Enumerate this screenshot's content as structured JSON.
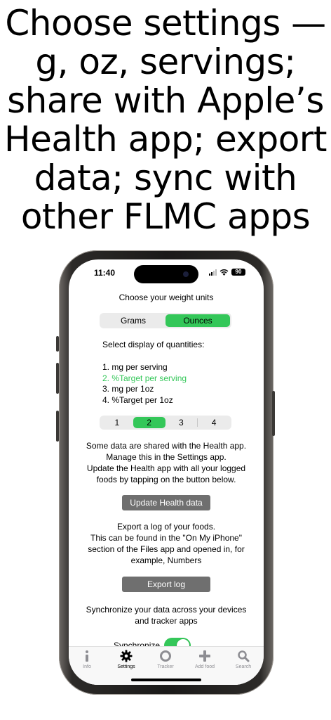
{
  "headline": [
    "Choose settings —",
    "g, oz, servings;",
    "share with Apple’s",
    "Health app; export",
    "data; sync with",
    "other FLMC apps"
  ],
  "status_bar": {
    "time": "11:40",
    "battery": "90",
    "icons": [
      "signal-icon",
      "wifi-icon",
      "battery-icon"
    ]
  },
  "weight_units": {
    "title": "Choose your weight units",
    "options": [
      "Grams",
      "Ounces"
    ],
    "selected": "Ounces"
  },
  "quantities": {
    "title": "Select display of quantities:",
    "items": [
      "1. mg per serving",
      "2. %Target per serving",
      "3. mg per 1oz",
      "4. %Target per 1oz"
    ],
    "segments": [
      "1",
      "2",
      "3",
      "4"
    ],
    "selected": "2"
  },
  "health": {
    "lines": [
      "Some data are shared with the Health app.",
      "Manage this in the Settings app.",
      "Update the Health app with all your logged",
      "foods by tapping on the button below."
    ],
    "button": "Update Health data"
  },
  "export": {
    "lines": [
      "Export a log of your foods.",
      "This can be found in the \"On My iPhone\"",
      "section of the Files app and opened in, for",
      "example, Numbers"
    ],
    "button": "Export log"
  },
  "sync": {
    "lines": [
      "Synchronize your data across your devices",
      "and tracker apps"
    ],
    "toggle_label": "Synchronize",
    "toggle_on": true
  },
  "tabs": [
    {
      "label": "Info",
      "icon": "info-icon"
    },
    {
      "label": "Settings",
      "icon": "gear-icon",
      "active": true
    },
    {
      "label": "Tracker",
      "icon": "circle-icon"
    },
    {
      "label": "Add food",
      "icon": "plus-icon"
    },
    {
      "label": "Search",
      "icon": "search-icon"
    }
  ],
  "colors": {
    "accent": "#34c759",
    "button_gray": "#6f6f6f",
    "tab_inactive": "#8e8e93"
  }
}
